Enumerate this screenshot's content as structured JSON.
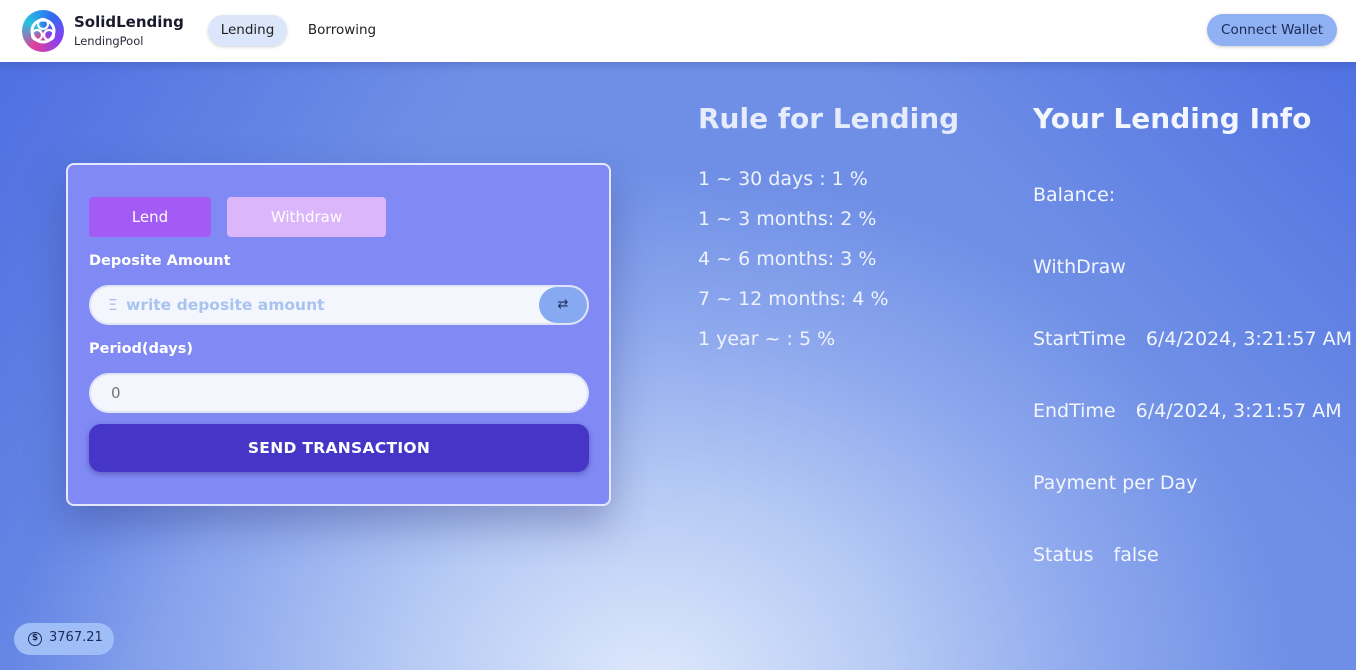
{
  "header": {
    "brand_title": "SolidLending",
    "brand_subtitle": "LendingPool",
    "tabs": [
      {
        "label": "Lending",
        "active": true
      },
      {
        "label": "Borrowing",
        "active": false
      }
    ],
    "connect_label": "Connect Wallet"
  },
  "form": {
    "tab_lend": "Lend",
    "tab_withdraw": "Withdraw",
    "deposit_label": "Deposite Amount",
    "deposit_currency_symbol": "Ξ",
    "deposit_placeholder": "write deposite amount",
    "swap_icon": "⇄",
    "period_label": "Period(days)",
    "period_placeholder": "0",
    "send_label": "SEND TRANSACTION"
  },
  "rules": {
    "title": "Rule for Lending",
    "items": [
      "1 ~ 30 days : 1 %",
      "1 ~ 3 months: 2 %",
      "4 ~ 6 months: 3 %",
      "7 ~ 12 months: 4 %",
      "1 year ~ : 5 %"
    ]
  },
  "info": {
    "title": "Your Lending Info",
    "balance_label": "Balance:",
    "withdraw_label": "WithDraw",
    "start_label": "StartTime",
    "start_value": "6/4/2024, 3:21:57 AM",
    "end_label": "EndTime",
    "end_value": "6/4/2024, 3:21:57 AM",
    "payment_label": "Payment per Day",
    "status_label": "Status",
    "status_value": "false"
  },
  "footer": {
    "coin_icon": "$",
    "balance_value": "3767.21"
  },
  "colors": {
    "accent": "#4536c8",
    "card": "#8189f4",
    "lend_button": "#a45af4",
    "withdraw_button": "#dcb6fb",
    "connect_button": "#8fb1f3"
  }
}
